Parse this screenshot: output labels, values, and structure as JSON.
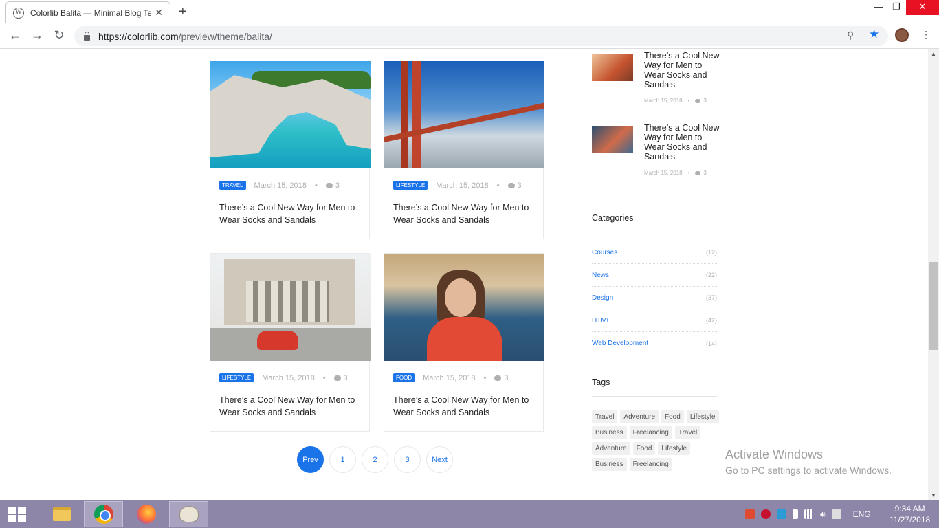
{
  "browser": {
    "tab_title": "Colorlib Balita — Minimal Blog Te",
    "url_host": "https://colorlib.com",
    "url_path": "/preview/theme/balita/",
    "window_controls": [
      "—",
      "❐",
      "✕"
    ]
  },
  "posts": [
    {
      "category": "TRAVEL",
      "date": "March 15, 2018",
      "comments": "3",
      "title": "There’s a Cool New Way for Men to Wear Socks and Sandals",
      "image": "sea-arch"
    },
    {
      "category": "LIFESTYLE",
      "date": "March 15, 2018",
      "comments": "3",
      "title": "There’s a Cool New Way for Men to Wear Socks and Sandals",
      "image": "golden-gate-bridge"
    },
    {
      "category": "LIFESTYLE",
      "date": "March 15, 2018",
      "comments": "3",
      "title": "There’s a Cool New Way for Men to Wear Socks and Sandals",
      "image": "couple-on-scooter"
    },
    {
      "category": "FOOD",
      "date": "March 15, 2018",
      "comments": "3",
      "title": "There’s a Cool New Way for Men to Wear Socks and Sandals",
      "image": "woman-with-drink"
    }
  ],
  "pagination": {
    "prev": "Prev",
    "pages": [
      "1",
      "2",
      "3"
    ],
    "next": "Next"
  },
  "sidebar": {
    "popular_posts": [
      {
        "title": "There’s a Cool New Way for Men to Wear Socks and Sandals",
        "date": "March 15, 2018",
        "comments": "3"
      },
      {
        "title": "There’s a Cool New Way for Men to Wear Socks and Sandals",
        "date": "March 15, 2018",
        "comments": "3"
      }
    ],
    "categories_title": "Categories",
    "categories": [
      {
        "name": "Courses",
        "count": "(12)"
      },
      {
        "name": "News",
        "count": "(22)"
      },
      {
        "name": "Design",
        "count": "(37)"
      },
      {
        "name": "HTML",
        "count": "(42)"
      },
      {
        "name": "Web Development",
        "count": "(14)"
      }
    ],
    "tags_title": "Tags",
    "tags": [
      "Travel",
      "Adventure",
      "Food",
      "Lifestyle",
      "Business",
      "Freelancing",
      "Travel",
      "Adventure",
      "Food",
      "Lifestyle",
      "Business",
      "Freelancing"
    ]
  },
  "watermark": {
    "line1": "Activate Windows",
    "line2": "Go to PC settings to activate Windows."
  },
  "taskbar": {
    "lang": "ENG",
    "time": "9:34 AM",
    "date": "11/27/2018"
  },
  "colors": {
    "accent": "#1a73e8",
    "taskbar": "#8d86a8"
  }
}
